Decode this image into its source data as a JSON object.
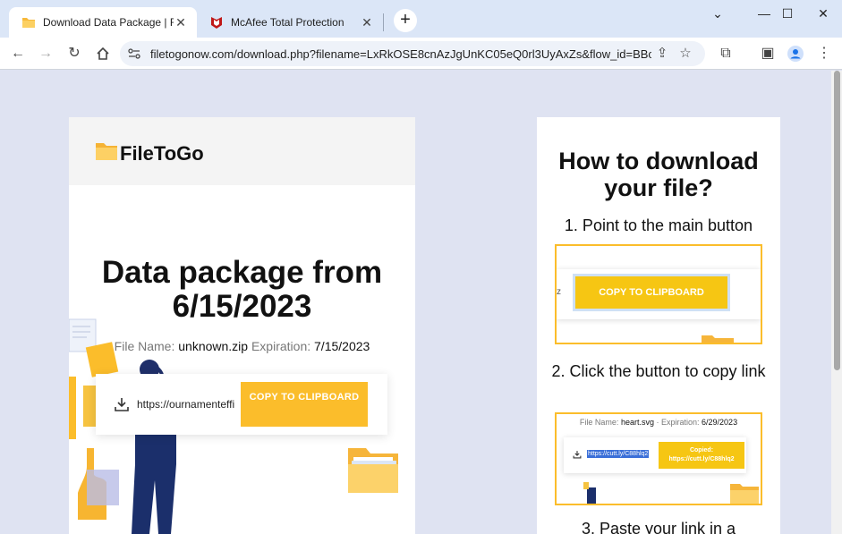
{
  "browser": {
    "tabs": [
      {
        "title": "Download Data Package | FileTo",
        "active": true
      },
      {
        "title": "McAfee Total Protection",
        "active": false
      }
    ],
    "new_tab": "+",
    "url": "filetogonow.com/download.php?filename=LxRkOSE8cnAzJgUnKC05eQ0rl3UyAxZs&flow_id=BBcldg%...",
    "window_controls": {
      "minimize": "—",
      "maximize": "☐",
      "close": "✕"
    },
    "dropdown": "⌄"
  },
  "left_card": {
    "brand": "FileToGo",
    "title": "Data package from 6/15/2023",
    "file_name_label": "File Name:",
    "file_name": "unknown.zip",
    "expiration_label": "Expiration:",
    "expiration": "7/15/2023",
    "link": "https://ournamenteffi",
    "copy_button": "COPY TO CLIPBOARD"
  },
  "right_card": {
    "heading": "How to download your file?",
    "step1": "1. Point to the main button",
    "step1_button": "COPY TO CLIPBOARD",
    "step2": "2. Click the button to copy link",
    "step2_file_name_label": "File Name:",
    "step2_file_name": "heart.svg",
    "step2_expiration_label": "· Expiration:",
    "step2_expiration": "6/29/2023",
    "step2_link": "https://cutt.ly/C88hlq2",
    "step2_copied_title": "Copied:",
    "step2_copied_link": "https://cutt.ly/C88hlq2",
    "step3": "3. Paste your link in a"
  },
  "colors": {
    "accent": "#fbbd2b",
    "page_bg": "#dfe3f2",
    "tabbar": "#dbe6f7"
  },
  "icons": [
    "folder-icon",
    "mcafee-icon",
    "back-icon",
    "forward-icon",
    "reload-icon",
    "home-icon",
    "site-info-icon",
    "share-icon",
    "star-icon",
    "extensions-icon",
    "sidebar-icon",
    "profile-icon",
    "menu-icon",
    "download-icon"
  ]
}
